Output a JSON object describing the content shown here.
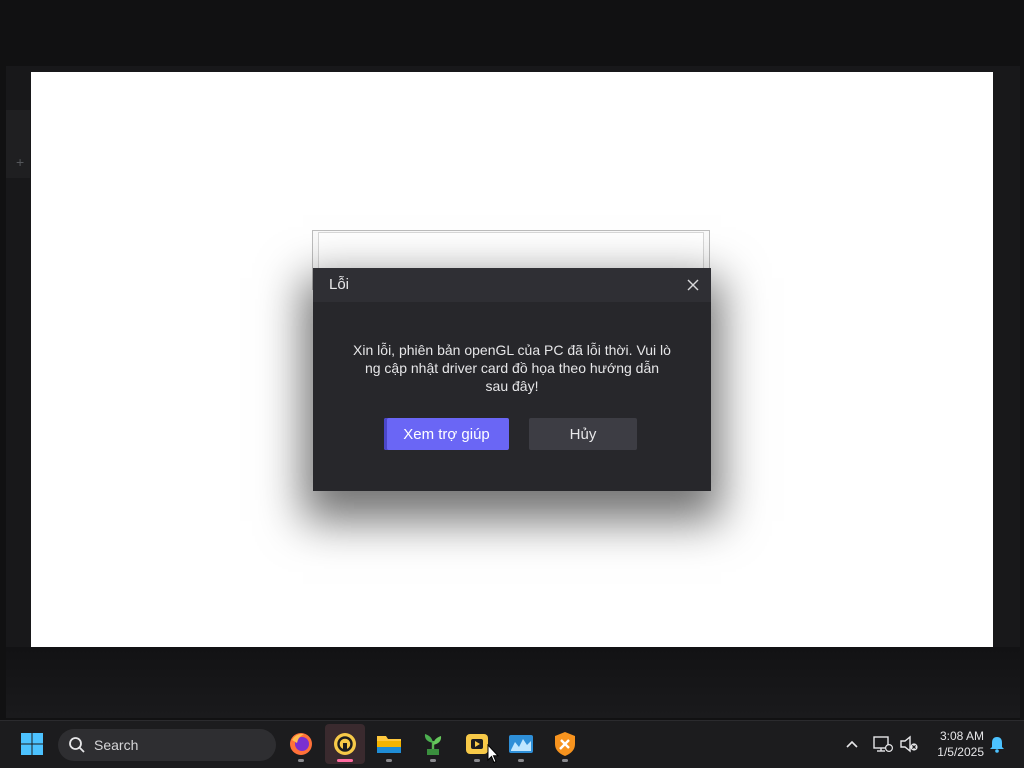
{
  "dialog": {
    "title": "Lỗi",
    "message_line1": "Xin lỗi, phiên bản openGL của PC đã lỗi thời. Vui lò",
    "message_line2": "ng cập nhật driver card đồ họa theo hướng dẫn",
    "message_line3": "sau đây!",
    "help_button": "Xem trợ giúp",
    "cancel_button": "Hủy"
  },
  "taskbar": {
    "search_placeholder": "Search",
    "apps": [
      {
        "name": "firefox-icon",
        "active": false
      },
      {
        "name": "app-launcher-icon",
        "active": true
      },
      {
        "name": "file-explorer-icon",
        "active": false
      },
      {
        "name": "plant-app-icon",
        "active": false
      },
      {
        "name": "media-app-icon",
        "active": false
      },
      {
        "name": "monitor-app-icon",
        "active": false
      },
      {
        "name": "shield-tools-icon",
        "active": false
      }
    ]
  },
  "tray": {
    "time": "3:08 AM",
    "date": "1/5/2025"
  },
  "colors": {
    "dialog_bg": "#27272b",
    "primary_button": "#6a66f5",
    "secondary_button": "#3d3d44",
    "taskbar_bg": "#1c1c1e"
  }
}
